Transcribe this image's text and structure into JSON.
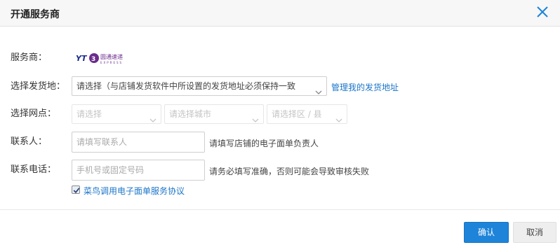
{
  "dialog": {
    "title": "开通服务商",
    "close_icon": "close-icon"
  },
  "form": {
    "provider": {
      "label": "服务商：",
      "logo_top": "YT",
      "logo_chinese": "圆通速递",
      "logo_sub": "EXPRESS"
    },
    "address": {
      "label": "选择发货地：",
      "select_text": "请选择（与店铺发货软件中所设置的发货地址必须保持一致",
      "manage_link": "管理我的发货地址"
    },
    "outlet": {
      "label": "选择网点：",
      "province_placeholder": "请选择",
      "city_placeholder": "请选择城市",
      "district_placeholder": "请选择区 / 县"
    },
    "contact": {
      "label": "联系人：",
      "placeholder": "请填写联系人",
      "hint": "请填写店铺的电子面单负责人"
    },
    "phone": {
      "label": "联系电话：",
      "placeholder": "手机号或固定号码",
      "hint": "请务必填写准确，否则可能会导致审核失败"
    },
    "agreement": {
      "checked": true,
      "text": "菜鸟调用电子面单服务协议"
    }
  },
  "footer": {
    "confirm_label": "确认",
    "cancel_label": "取消"
  },
  "colors": {
    "accent": "#1d84d9",
    "link": "#1a75c9",
    "logo_blue": "#1a2b8c",
    "logo_purple": "#6a2c8c"
  }
}
